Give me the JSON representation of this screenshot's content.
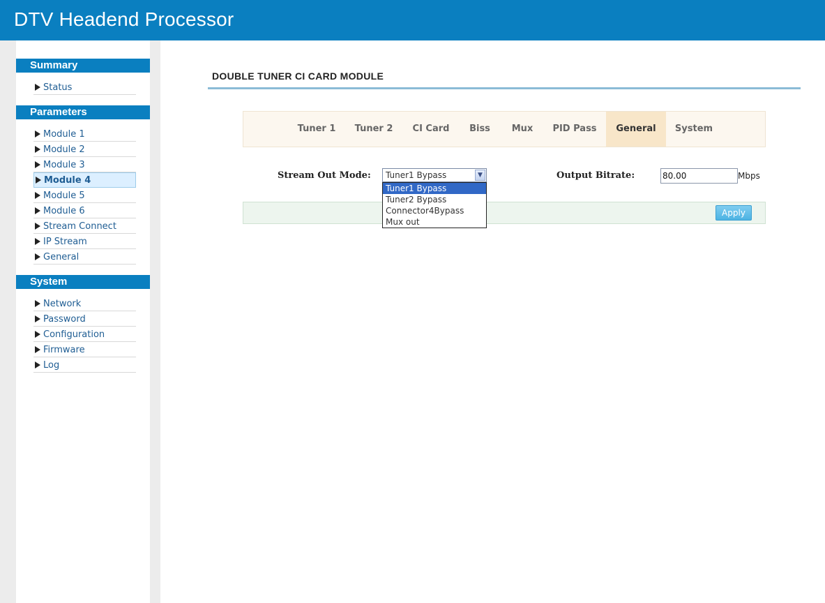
{
  "header": {
    "title": "DTV Headend Processor"
  },
  "sidebar": {
    "sections": [
      {
        "title": "Summary",
        "items": [
          {
            "label": "Status"
          }
        ]
      },
      {
        "title": "Parameters",
        "items": [
          {
            "label": "Module 1"
          },
          {
            "label": "Module 2"
          },
          {
            "label": "Module 3"
          },
          {
            "label": "Module 4",
            "active": true
          },
          {
            "label": "Module 5"
          },
          {
            "label": "Module 6"
          },
          {
            "label": "Stream Connect"
          },
          {
            "label": "IP Stream"
          },
          {
            "label": "General"
          }
        ]
      },
      {
        "title": "System",
        "items": [
          {
            "label": "Network"
          },
          {
            "label": "Password"
          },
          {
            "label": "Configuration"
          },
          {
            "label": "Firmware"
          },
          {
            "label": "Log"
          }
        ]
      }
    ]
  },
  "page": {
    "heading": "DOUBLE TUNER CI CARD MODULE"
  },
  "tabs": [
    {
      "label": "Tuner 1"
    },
    {
      "label": "Tuner 2"
    },
    {
      "label": "CI Card"
    },
    {
      "label": "Biss"
    },
    {
      "label": "Mux"
    },
    {
      "label": "PID Pass"
    },
    {
      "label": "General",
      "active": true
    },
    {
      "label": "System"
    }
  ],
  "form": {
    "stream_out_mode": {
      "label": "Stream Out Mode:",
      "value": "Tuner1 Bypass",
      "options": [
        "Tuner1 Bypass",
        "Tuner2 Bypass",
        "Connector4Bypass",
        "Mux out"
      ]
    },
    "output_bitrate": {
      "label": "Output Bitrate:",
      "value": "80.00",
      "unit": "Mbps"
    },
    "apply_label": "Apply"
  },
  "colors": {
    "header": "#0a7fc0",
    "tab_active": "#f8e6c9",
    "selected_option": "#3168c6"
  }
}
